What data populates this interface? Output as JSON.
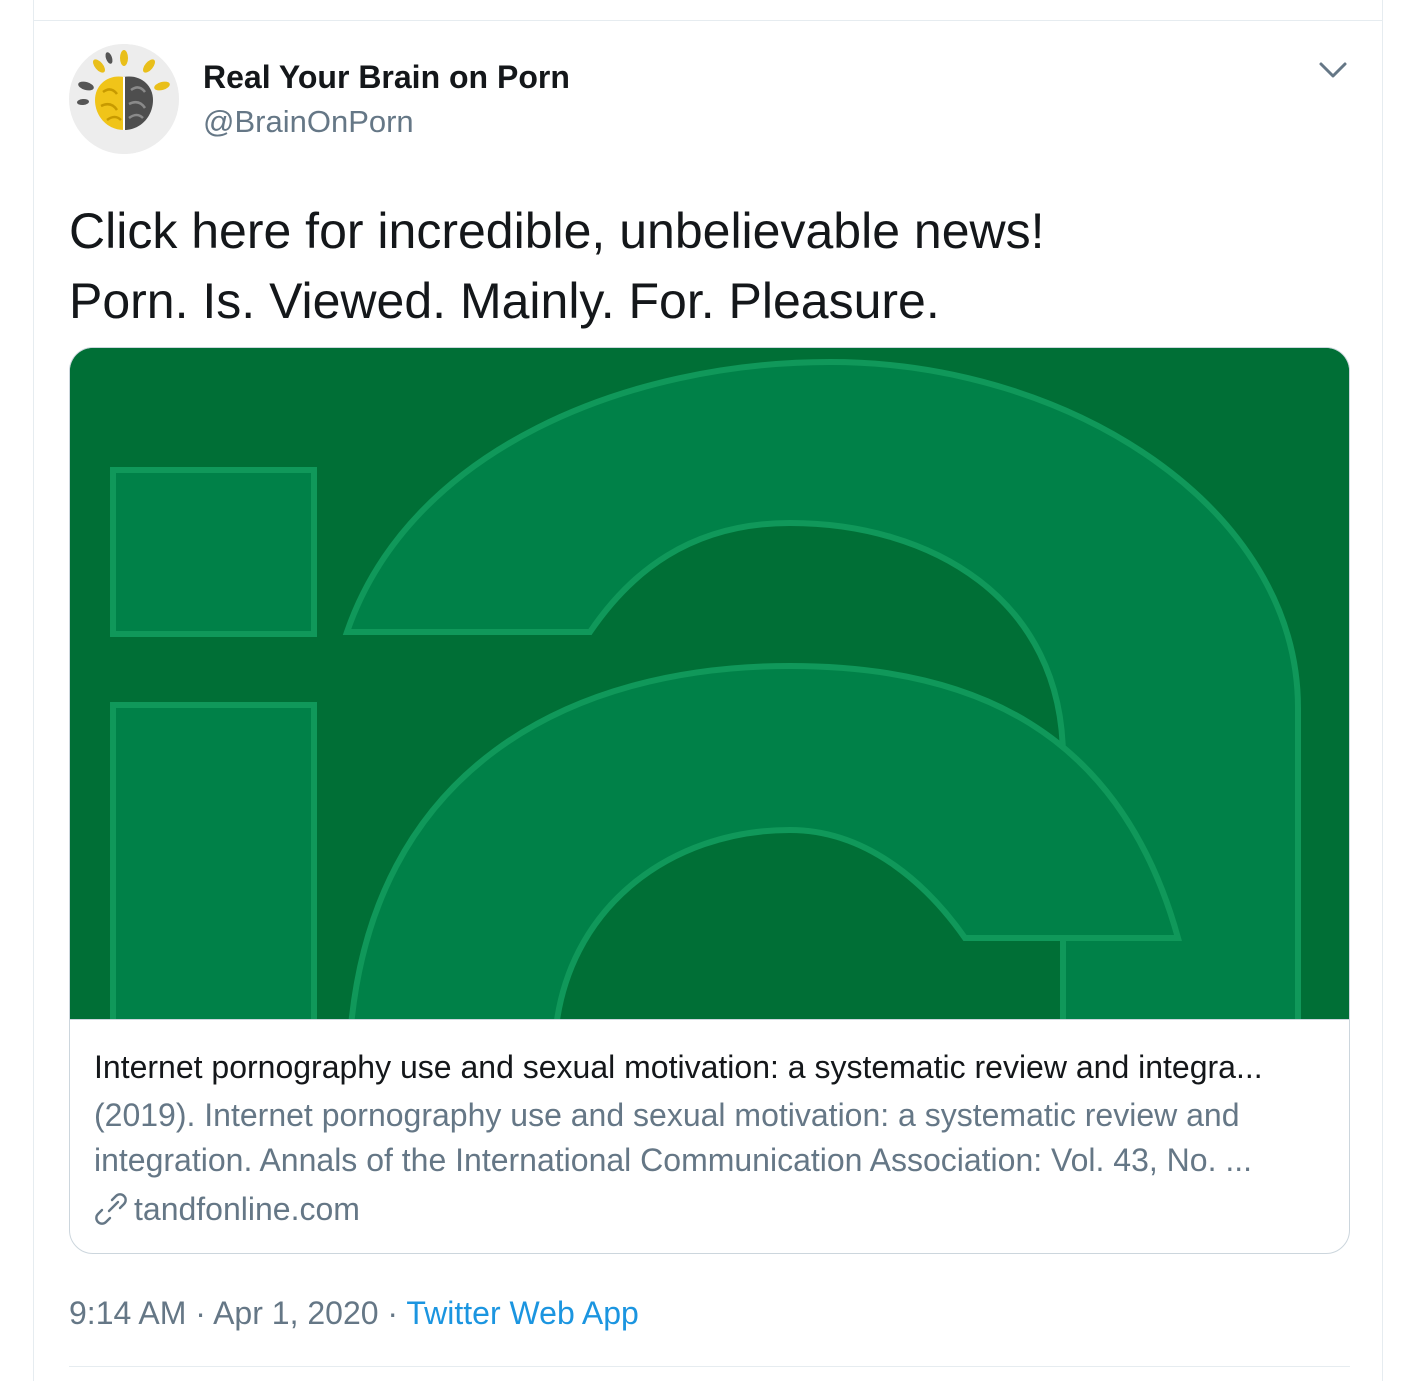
{
  "author": {
    "display_name": "Real Your Brain on Porn",
    "handle": "@BrainOnPorn",
    "avatar_icon": "brain-logo-icon"
  },
  "tweet": {
    "lines": [
      "Click here for incredible, unbelievable news!",
      "Porn. Is. Viewed. Mainly. For. Pleasure."
    ]
  },
  "card": {
    "image_icon": "publisher-logo-image",
    "image_bg_color": "#006f36",
    "shape_color": "#008148",
    "outline_color": "#10985a",
    "title": "Internet pornography use and sexual motivation: a systematic review and integra...",
    "description_lines": [
      "(2019). Internet pornography use and sexual motivation: a systematic review and",
      "integration. Annals of the International Communication Association: Vol. 43, No. ..."
    ],
    "domain": "tandfonline.com",
    "domain_icon": "link-icon"
  },
  "meta": {
    "time": "9:14 AM",
    "separator": " · ",
    "date": "Apr 1, 2020",
    "source": "Twitter Web App",
    "source_color": "#1b95e0"
  },
  "menu": {
    "icon": "chevron-down-icon"
  }
}
